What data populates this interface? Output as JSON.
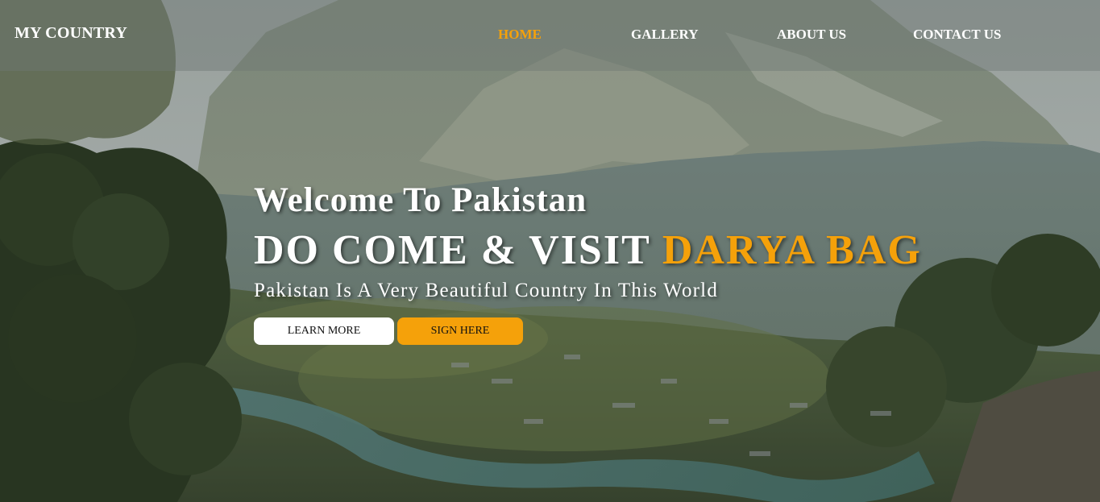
{
  "brand": "MY COUNTRY",
  "nav": {
    "items": [
      {
        "label": "HOME",
        "active": true
      },
      {
        "label": "GALLERY",
        "active": false
      },
      {
        "label": "ABOUT US",
        "active": false
      },
      {
        "label": "CONTACT US",
        "active": false
      }
    ]
  },
  "hero": {
    "welcome": "Welcome To Pakistan",
    "headline_prefix": "DO COME & VISIT",
    "headline_highlight": "DARYA BAG",
    "tagline": "Pakistan Is A Very Beautiful Country In This World",
    "learn_more_label": "LEARN MORE",
    "sign_here_label": "SIGN HERE"
  },
  "colors": {
    "accent": "#f5a10a",
    "text": "#ffffff",
    "button_light": "#ffffff"
  }
}
